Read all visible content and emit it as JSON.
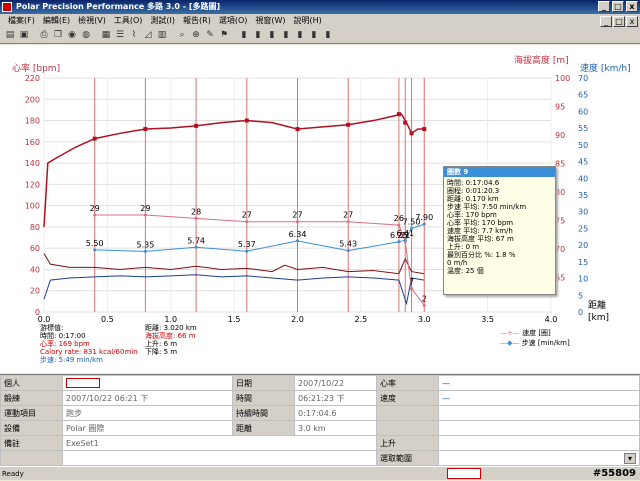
{
  "window": {
    "title": "Polar Precision Performance 多路 3.0 - [多路圖]"
  },
  "menu": [
    "檔案(F)",
    "編輯(E)",
    "檢視(V)",
    "工具(O)",
    "測試(I)",
    "報告(R)",
    "選項(O)",
    "視窗(W)",
    "說明(H)"
  ],
  "window_buttons": [
    "_",
    "□",
    "x"
  ],
  "axes": {
    "left_title": "心率 [bpm]",
    "right_alt_title": "海拔高度 [m]",
    "right_speed_title": "速度 [km/h]",
    "x_title": "距離",
    "x_unit": "[km]",
    "left_ticks": [
      "220",
      "200",
      "180",
      "160",
      "140",
      "120",
      "100",
      "80",
      "60",
      "40",
      "20",
      "0"
    ],
    "alt_ticks": [
      "100",
      "95",
      "90",
      "85",
      "80",
      "75",
      "70",
      "65"
    ],
    "speed_ticks": [
      "70",
      "65",
      "60",
      "55",
      "50",
      "45",
      "40",
      "35",
      "30",
      "25",
      "20",
      "15",
      "10",
      "5",
      "0"
    ],
    "x_ticks": [
      "0.0",
      "0.5",
      "1.0",
      "1.5",
      "2.0",
      "2.5",
      "3.0",
      "3.5",
      "4.0"
    ]
  },
  "chart_data": {
    "type": "line",
    "x_unit": "km",
    "xlim": [
      0,
      4
    ],
    "ylim_hr": [
      0,
      220
    ],
    "series": [
      {
        "name": "速度 [km/h]",
        "color": "#d87080",
        "x": [
          0.4,
          0.8,
          1.2,
          1.6,
          2.0,
          2.4,
          2.8,
          2.85,
          2.9,
          3.0
        ],
        "values": [
          29,
          29,
          28,
          27,
          27,
          27,
          26,
          21,
          7,
          2
        ]
      },
      {
        "name": "步速 [min/km]",
        "color": "#3a8fd8",
        "x": [
          0.4,
          0.8,
          1.2,
          1.6,
          2.0,
          2.4,
          2.8,
          2.85,
          2.9,
          3.0
        ],
        "values": [
          5.5,
          5.35,
          5.74,
          5.37,
          6.34,
          5.43,
          6.25,
          6.41,
          7.5,
          7.9
        ]
      }
    ],
    "point_labels_speed": [
      "29",
      "29",
      "28",
      "27",
      "27",
      "27",
      "26",
      "21",
      "7",
      "2"
    ],
    "point_labels_pace": [
      "5.50",
      "5.35",
      "5.74",
      "5.37",
      "6.34",
      "5.43",
      "6.25",
      "6.41",
      "7.50",
      "7.90"
    ]
  },
  "popup": {
    "header": "圈數 9",
    "lines": [
      "時間: 0:17:04.6",
      "圈程: 0:01:20.3",
      "距離: 0.170 km",
      "步速 平均: 7:50 min/km",
      "心率: 170 bpm",
      "心率 平均: 170 bpm",
      "速度 平均: 7.7 km/h",
      "海拔高度 平均: 67 m",
      "上升: 0 m",
      "最別百分比 %: 1.8 %",
      "0 m/h",
      "溫度: 25 個"
    ]
  },
  "legend": [
    "速度 [圈]",
    "步速 [min/km]"
  ],
  "stats": {
    "left": [
      "游標值:",
      "時間: 0:17:00",
      "心率: 169 bpm",
      "Calory rate: 831 kcal/60min",
      "步速: 5:49 min/km"
    ],
    "right": [
      "距離: 3.020 km",
      "海拔高度: 66 m",
      "上升: 6 m",
      "下降: 5 m"
    ]
  },
  "info": {
    "rows": [
      [
        "個人",
        "",
        "日期",
        "2007/10/22",
        "心率",
        ""
      ],
      [
        "鍛練",
        "2007/10/22 06:21 下",
        "時間",
        "06:21:23 下",
        "速度",
        ""
      ],
      [
        "運動項目",
        "跑步",
        "持續時間",
        "0:17:04.6",
        "",
        ""
      ],
      [
        "設備",
        "Polar 圓際",
        "距離",
        "3.0 km",
        "",
        ""
      ],
      [
        "備註",
        "ExeSet1",
        "",
        "",
        "上升",
        ""
      ],
      [
        "",
        "",
        "",
        "",
        "選取範圍",
        ""
      ]
    ]
  },
  "status": {
    "text": "Ready",
    "right": "#55809"
  }
}
